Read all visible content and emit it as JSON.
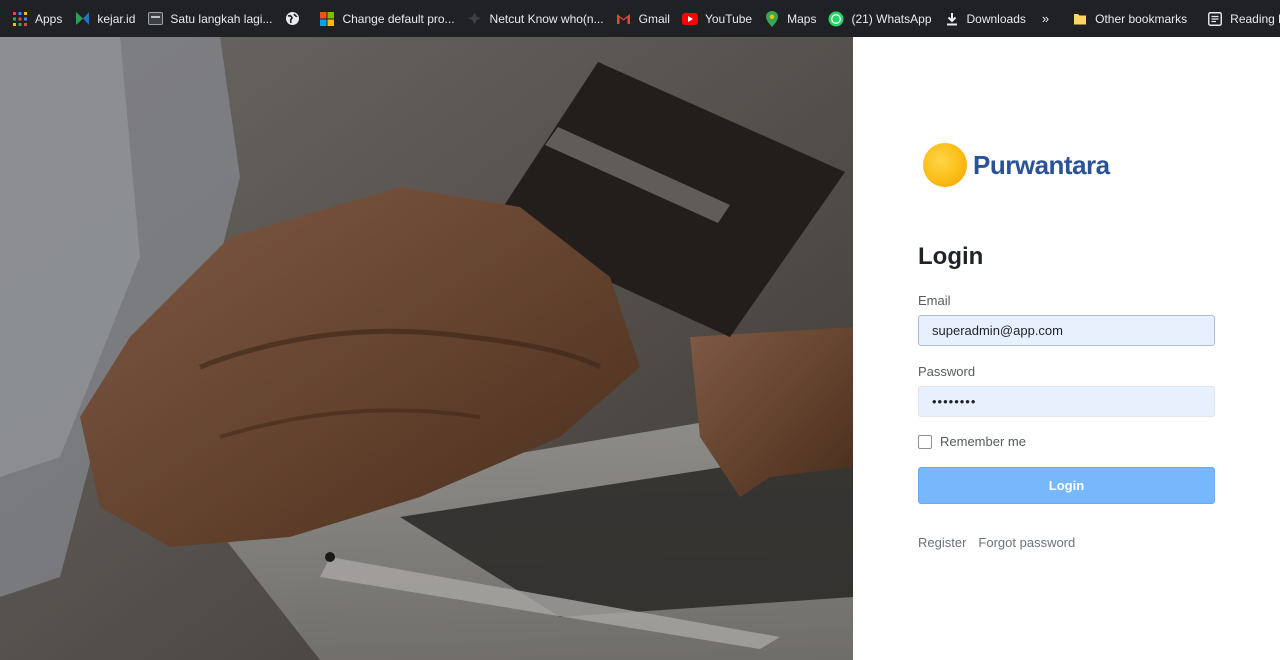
{
  "bookmarks": [
    {
      "icon": "apps-grid-icon",
      "label": "Apps"
    },
    {
      "icon": "kejar-icon",
      "label": "kejar.id"
    },
    {
      "icon": "page-thumbnail-icon",
      "label": "Satu langkah lagi..."
    },
    {
      "icon": "globe-icon",
      "label": ""
    },
    {
      "icon": "microsoft-icon",
      "label": "Change default pro..."
    },
    {
      "icon": "netcut-icon",
      "label": "Netcut Know who(n..."
    },
    {
      "icon": "gmail-icon",
      "label": "Gmail"
    },
    {
      "icon": "youtube-icon",
      "label": "YouTube"
    },
    {
      "icon": "maps-pin-icon",
      "label": "Maps"
    },
    {
      "icon": "whatsapp-icon",
      "label": "(21) WhatsApp"
    },
    {
      "icon": "download-icon",
      "label": "Downloads"
    }
  ],
  "bookmarks_overflow": "»",
  "other_bookmarks": "Other bookmarks",
  "reading_list": "Reading list",
  "brand": {
    "name": "Purwantara"
  },
  "login": {
    "title": "Login",
    "email_label": "Email",
    "email_value": "superadmin@app.com",
    "password_label": "Password",
    "password_value": "••••••••",
    "remember_label": "Remember me",
    "submit_label": "Login",
    "register_link": "Register",
    "forgot_link": "Forgot password"
  },
  "colors": {
    "brand_blue": "#2a5298",
    "brand_yellow": "#fbbd14",
    "button": "#76b8fb",
    "input_fill": "#e8f0fe"
  }
}
